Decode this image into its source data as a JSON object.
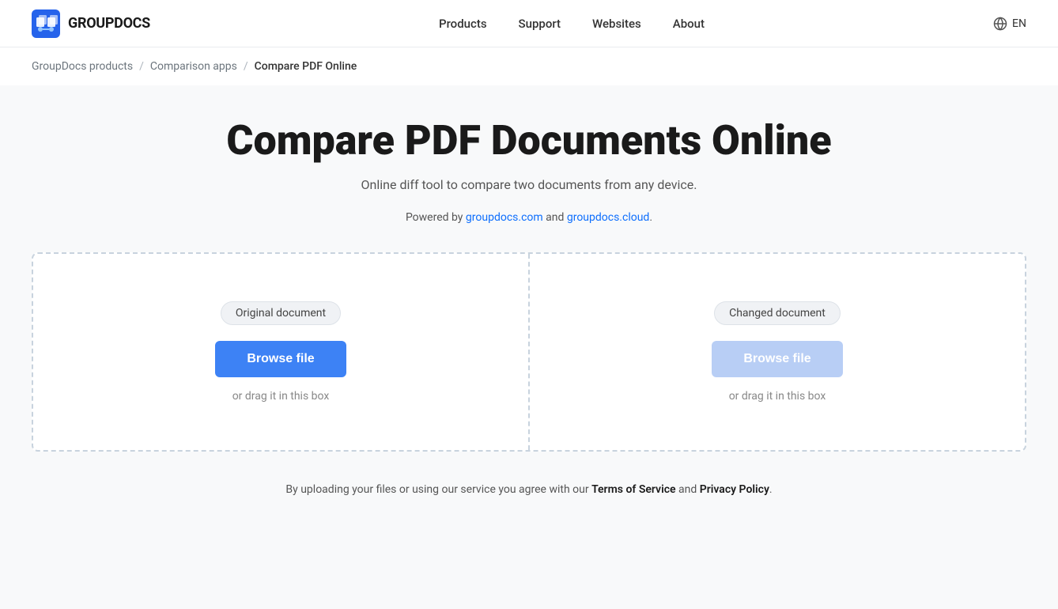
{
  "header": {
    "logo_text": "GROUPDOCS",
    "nav_items": [
      {
        "label": "Products",
        "href": "#"
      },
      {
        "label": "Support",
        "href": "#"
      },
      {
        "label": "Websites",
        "href": "#"
      },
      {
        "label": "About",
        "href": "#"
      }
    ],
    "lang_label": "EN"
  },
  "breadcrumb": {
    "items": [
      {
        "label": "GroupDocs products",
        "href": "#"
      },
      {
        "label": "Comparison apps",
        "href": "#"
      },
      {
        "label": "Compare PDF Online",
        "href": null
      }
    ]
  },
  "main": {
    "title": "Compare PDF Documents Online",
    "subtitle": "Online diff tool to compare two documents from any device.",
    "powered_by_prefix": "Powered by ",
    "powered_by_link1_text": "groupdocs.com",
    "powered_by_link1_href": "#",
    "powered_by_and": " and ",
    "powered_by_link2_text": "groupdocs.cloud",
    "powered_by_link2_href": "#",
    "powered_by_suffix": ".",
    "upload_left": {
      "label": "Original document",
      "button_text": "Browse file",
      "drag_text": "or drag it in this box"
    },
    "upload_right": {
      "label": "Changed document",
      "button_text": "Browse file",
      "drag_text": "or drag it in this box"
    },
    "footer_note_prefix": "By uploading your files or using our service you agree with our ",
    "tos_label": "Terms of Service",
    "footer_and": " and ",
    "privacy_label": "Privacy Policy",
    "footer_suffix": "."
  }
}
